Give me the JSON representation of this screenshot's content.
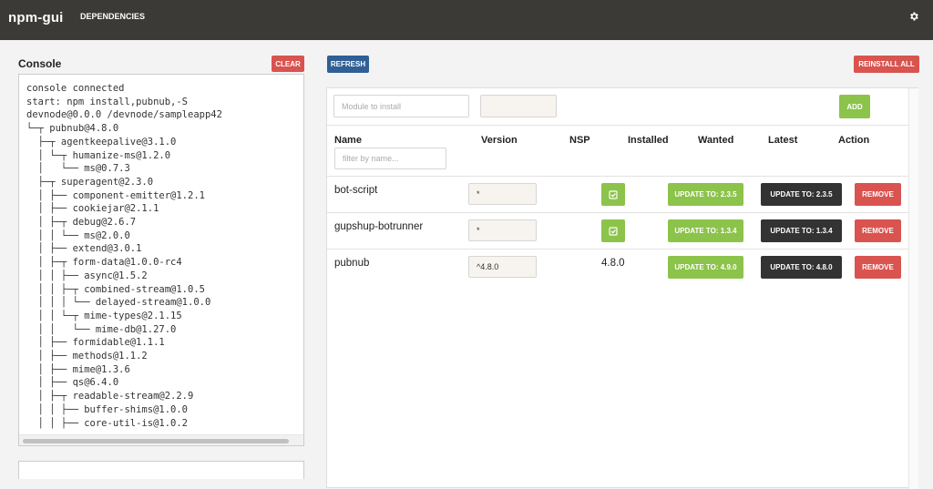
{
  "app": {
    "title": "npm-gui",
    "nav_dependencies": "DEPENDENCIES",
    "settings_icon": "gear-icon"
  },
  "console": {
    "title": "Console",
    "clear_label": "CLEAR",
    "lines": [
      "console connected",
      "start: npm install,pubnub,-S",
      "devnode@0.0.0 /devnode/sampleapp42",
      "└─┬ pubnub@4.8.0",
      "  ├─┬ agentkeepalive@3.1.0",
      "  │ └─┬ humanize-ms@1.2.0",
      "  │   └── ms@0.7.3",
      "  ├─┬ superagent@2.3.0",
      "  │ ├── component-emitter@1.2.1",
      "  │ ├── cookiejar@2.1.1",
      "  │ ├─┬ debug@2.6.7",
      "  │ │ └── ms@2.0.0",
      "  │ ├── extend@3.0.1",
      "  │ ├─┬ form-data@1.0.0-rc4",
      "  │ │ ├── async@1.5.2",
      "  │ │ ├─┬ combined-stream@1.0.5",
      "  │ │ │ └── delayed-stream@1.0.0",
      "  │ │ └─┬ mime-types@2.1.15",
      "  │ │   └── mime-db@1.27.0",
      "  │ ├── formidable@1.1.1",
      "  │ ├── methods@1.1.2",
      "  │ ├── mime@1.3.6",
      "  │ ├── qs@6.4.0",
      "  │ ├─┬ readable-stream@2.2.9",
      "  │ │ ├── buffer-shims@1.0.0",
      "  │ │ ├── core-util-is@1.0.2"
    ]
  },
  "toolbar": {
    "refresh_label": "REFRESH",
    "reinstall_label": "REINSTALL ALL"
  },
  "install": {
    "module_placeholder": "Module to install",
    "version_value": "",
    "add_label": "ADD"
  },
  "table": {
    "headers": {
      "name": "Name",
      "version": "Version",
      "nsp": "NSP",
      "installed": "Installed",
      "wanted": "Wanted",
      "latest": "Latest",
      "action": "Action"
    },
    "filter_placeholder": "filter by name...",
    "rows": [
      {
        "name": "bot-script",
        "version": "*",
        "installed": "",
        "wanted": "UPDATE TO: 2.3.5",
        "latest": "UPDATE TO: 2.3.5",
        "remove": "REMOVE"
      },
      {
        "name": "gupshup-botrunner",
        "version": "*",
        "installed": "",
        "wanted": "UPDATE TO: 1.3.4",
        "latest": "UPDATE TO: 1.3.4",
        "remove": "REMOVE"
      },
      {
        "name": "pubnub",
        "version": "^4.8.0",
        "installed": "4.8.0",
        "wanted": "UPDATE TO: 4.9.0",
        "latest": "UPDATE TO: 4.8.0",
        "remove": "REMOVE"
      }
    ]
  },
  "colors": {
    "topbar": "#3b3a36",
    "red": "#d9534f",
    "blue": "#2f5f95",
    "green": "#8cc34b",
    "dark": "#333333"
  }
}
